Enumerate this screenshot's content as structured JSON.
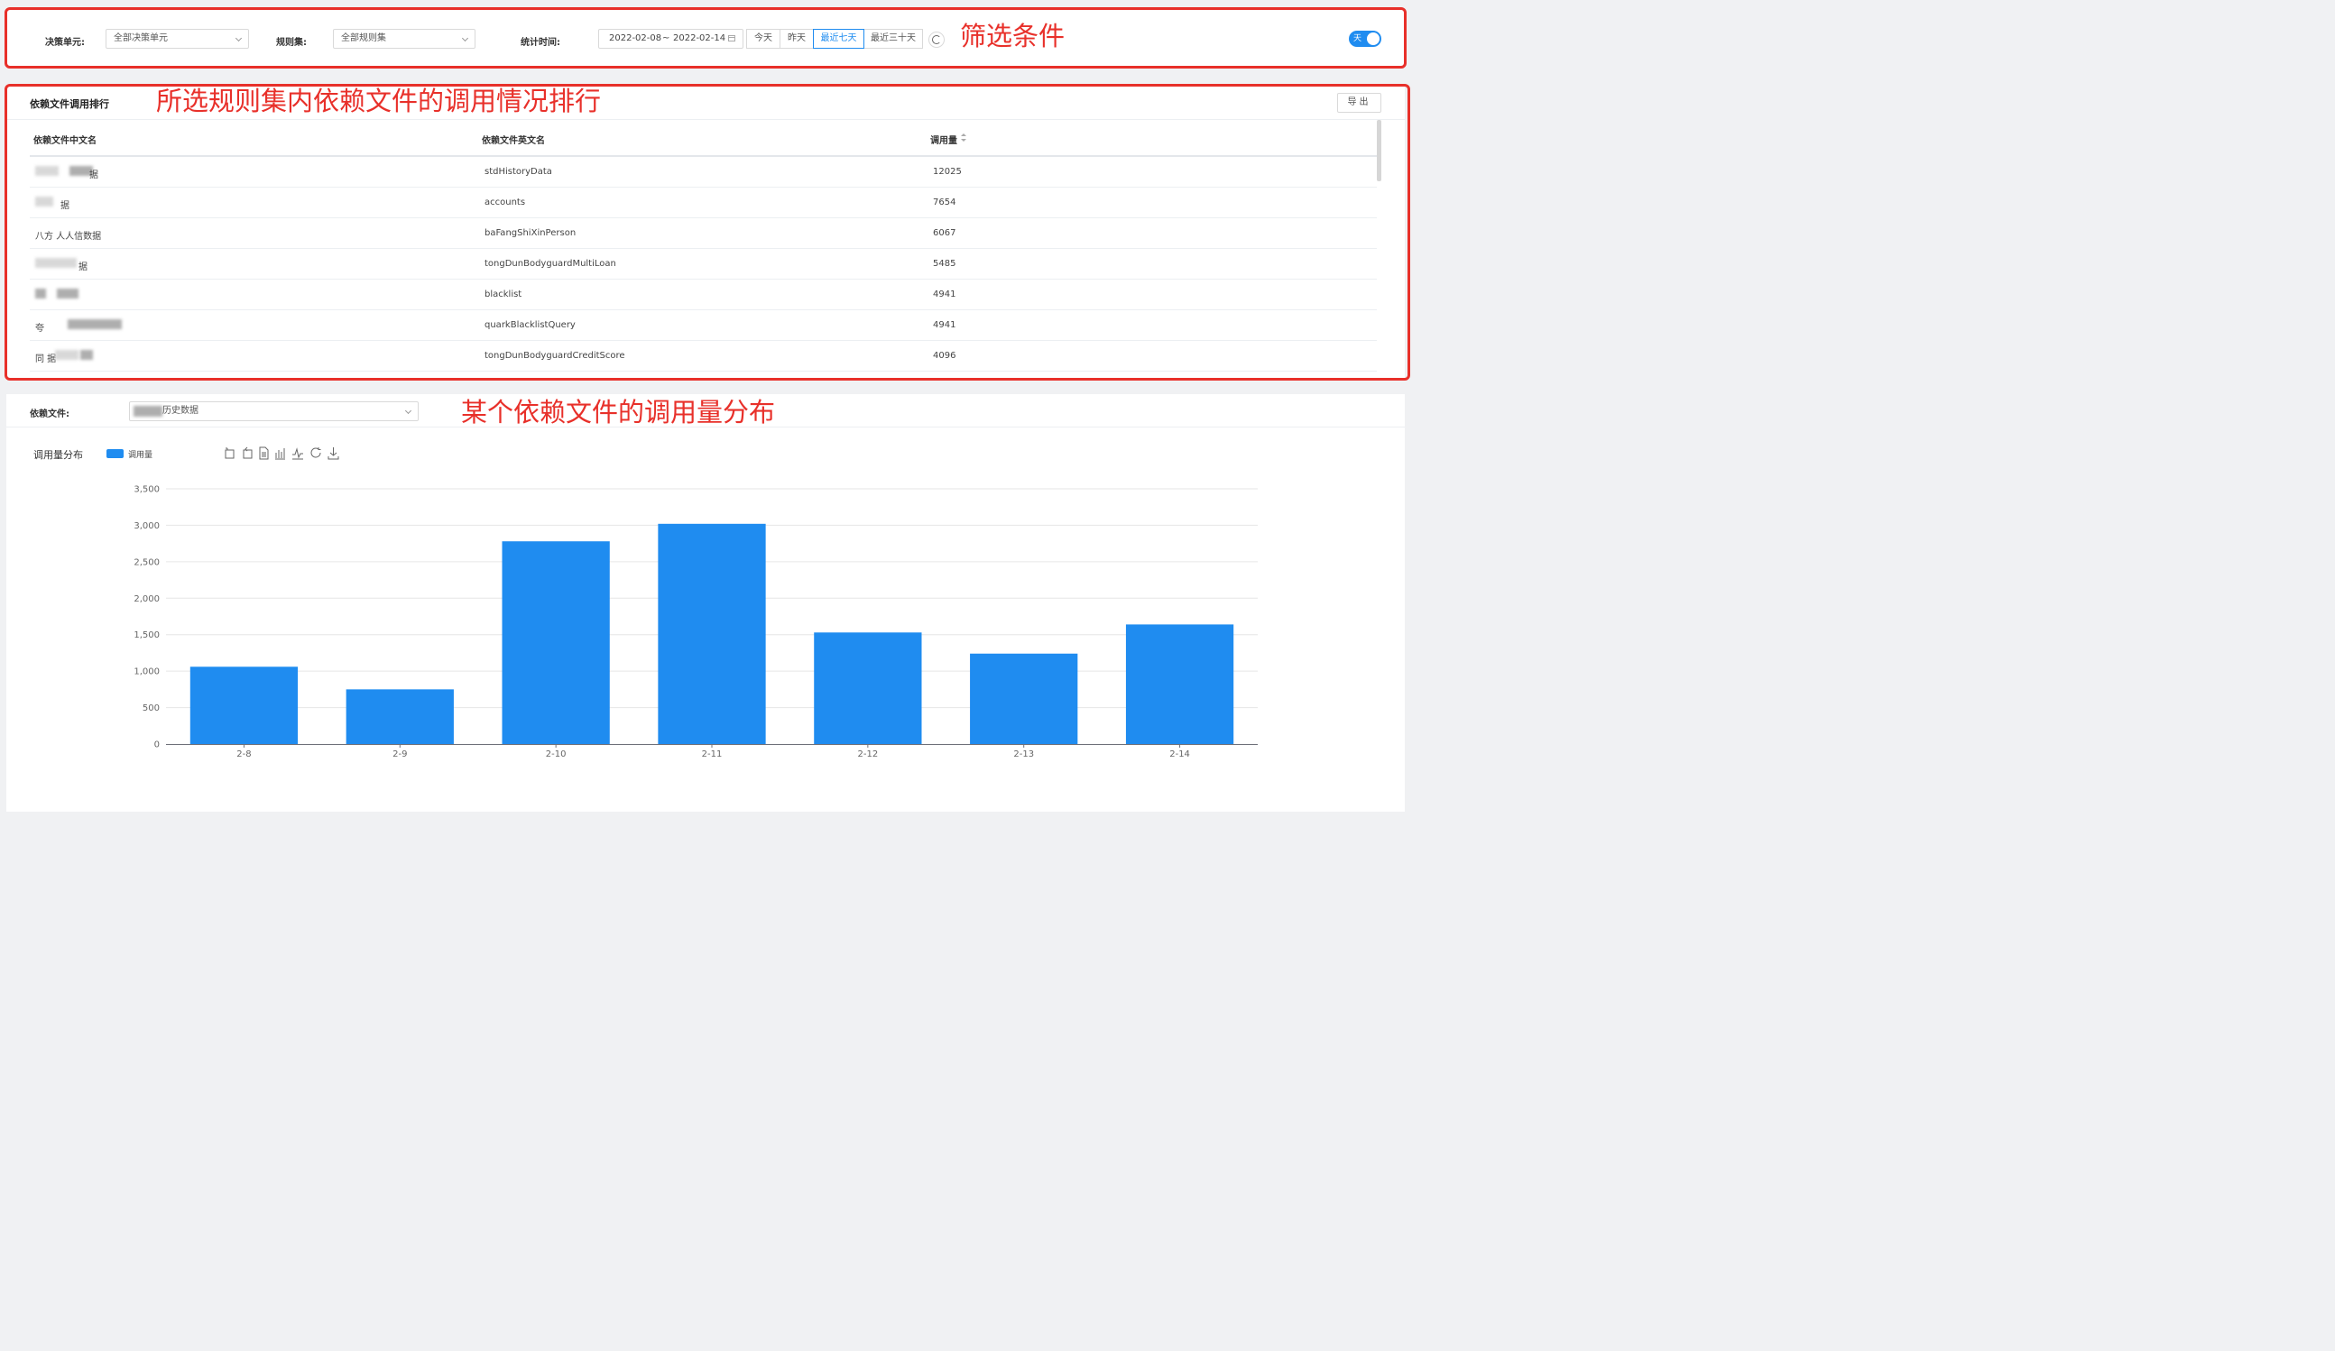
{
  "filters": {
    "decision_unit": {
      "label": "决策单元:",
      "value": "全部决策单元"
    },
    "rule_set": {
      "label": "规则集:",
      "value": "全部规则集"
    },
    "stats_time": {
      "label": "统计时间:",
      "start": "2022-02-08",
      "separator": "~",
      "end": "2022-02-14",
      "quick_ranges": [
        "今天",
        "昨天",
        "最近七天",
        "最近三十天"
      ],
      "active_range": "最近七天"
    },
    "toggle": {
      "label": "天",
      "on": true
    }
  },
  "table_panel": {
    "title": "依赖文件调用排行",
    "export_label": "导出",
    "columns": [
      "依赖文件中文名",
      "依赖文件英文名",
      "调用量"
    ],
    "rows": [
      {
        "cn": "据",
        "en": "stdHistoryData",
        "count": "12025"
      },
      {
        "cn": "据",
        "en": "accounts",
        "count": "7654"
      },
      {
        "cn": "八方 人人信数据",
        "en": "baFangShiXinPerson",
        "count": "6067"
      },
      {
        "cn": "据",
        "en": "tongDunBodyguardMultiLoan",
        "count": "5485"
      },
      {
        "cn": "",
        "en": "blacklist",
        "count": "4941"
      },
      {
        "cn": "夸",
        "en": "quarkBlacklistQuery",
        "count": "4941"
      },
      {
        "cn": "同 据",
        "en": "tongDunBodyguardCreditScore",
        "count": "4096"
      }
    ]
  },
  "chart_panel": {
    "file_label": "依赖文件:",
    "file_value": "历史数据",
    "chart_title": "调用量分布",
    "legend_label": "调用量",
    "toolbox_icons": [
      "zoom-icon",
      "zoom-reset-icon",
      "data-view-icon",
      "bar-type-icon",
      "line-type-icon",
      "restore-icon",
      "download-icon"
    ]
  },
  "annotations": {
    "filters": "筛选条件",
    "table": "所选规则集内依赖文件的调用情况排行",
    "chart": "某个依赖文件的调用量分布"
  },
  "colors": {
    "accent": "#1f8cf0",
    "annotation": "#e8302a"
  },
  "chart_data": {
    "type": "bar",
    "title": "调用量分布",
    "categories": [
      "2-8",
      "2-9",
      "2-10",
      "2-11",
      "2-12",
      "2-13",
      "2-14"
    ],
    "series": [
      {
        "name": "调用量",
        "values": [
          1060,
          750,
          2780,
          3020,
          1530,
          1240,
          1640
        ]
      }
    ],
    "yticks": [
      "0",
      "500",
      "1,000",
      "1,500",
      "2,000",
      "2,500",
      "3,000",
      "3,500"
    ],
    "ylim": [
      0,
      3500
    ],
    "grid": true,
    "legend": "top-left",
    "xlabel": "",
    "ylabel": ""
  }
}
